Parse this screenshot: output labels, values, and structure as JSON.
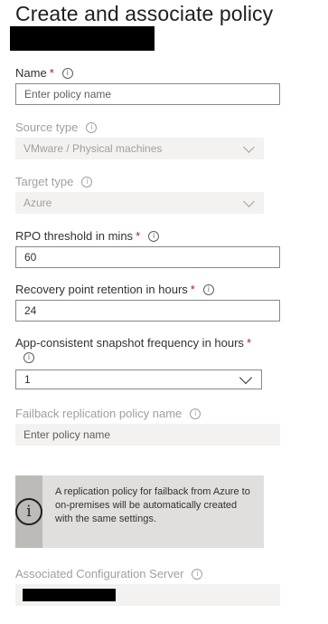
{
  "title": "Create and associate policy",
  "info_glyph": "i",
  "required_mark": "*",
  "fields": {
    "name": {
      "label": "Name",
      "placeholder": "Enter policy name",
      "value": ""
    },
    "source_type": {
      "label": "Source type",
      "value": "VMware / Physical machines"
    },
    "target_type": {
      "label": "Target type",
      "value": "Azure"
    },
    "rpo": {
      "label": "RPO threshold in mins",
      "value": "60"
    },
    "retention": {
      "label": "Recovery point retention in hours",
      "value": "24"
    },
    "app_consistent": {
      "label": "App-consistent snapshot frequency in hours",
      "value": "1"
    },
    "failback": {
      "label": "Failback replication policy name",
      "placeholder": "Enter policy name"
    },
    "config_server": {
      "label": "Associated Configuration Server"
    }
  },
  "banner": {
    "icon": "info-icon",
    "text": "A replication policy for failback from Azure to on-premises will be automatically created with the same settings."
  },
  "colors": {
    "required": "#a4262c",
    "disabled_text": "#a19f9d",
    "disabled_bg": "#f3f2f1",
    "banner_bg": "#e1dfdd",
    "banner_icon_bg": "#bdbbb8"
  }
}
